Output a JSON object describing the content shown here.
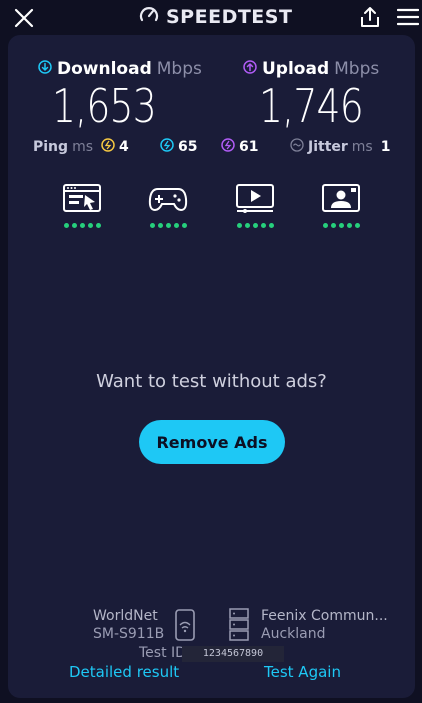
{
  "header": {
    "brand": "SPEEDTEST",
    "close_icon": "close-icon",
    "share_icon": "share-icon",
    "menu_icon": "hamburger-menu-icon"
  },
  "download": {
    "label": "Download",
    "unit": "Mbps",
    "value": "1,653",
    "icon": "download-arrow-icon",
    "color": "#1ec8f5"
  },
  "upload": {
    "label": "Upload",
    "unit": "Mbps",
    "value": "1,746",
    "icon": "upload-arrow-icon",
    "color": "#b05cf5"
  },
  "ping": {
    "label": "Ping",
    "unit": "ms",
    "idle": "4",
    "download": "65",
    "upload": "61",
    "idle_color": "#f5c842",
    "download_color": "#1ec8f5",
    "upload_color": "#b05cf5"
  },
  "jitter": {
    "label": "Jitter",
    "unit": "ms",
    "value": "1"
  },
  "experience": [
    {
      "name": "web-browsing",
      "icon": "browser-cursor-icon",
      "rating": 5
    },
    {
      "name": "gaming",
      "icon": "gamepad-icon",
      "rating": 5
    },
    {
      "name": "video-streaming",
      "icon": "video-play-icon",
      "rating": 5
    },
    {
      "name": "video-chat",
      "icon": "video-call-icon",
      "rating": 5
    }
  ],
  "promo": {
    "text": "Want to test without ads?",
    "button": "Remove Ads"
  },
  "footer": {
    "provider": "WorldNet",
    "device": "SM-S911B",
    "server_name": "Feenix Commun...",
    "server_location": "Auckland",
    "test_id_label": "Test ID",
    "test_id_value": "1234567890",
    "detailed_link": "Detailed result",
    "again_link": "Test Again"
  },
  "colors": {
    "background": "#0f1022",
    "card": "#1a1c38",
    "accent": "#1ec8f5",
    "rating_dot": "#26d07c"
  }
}
